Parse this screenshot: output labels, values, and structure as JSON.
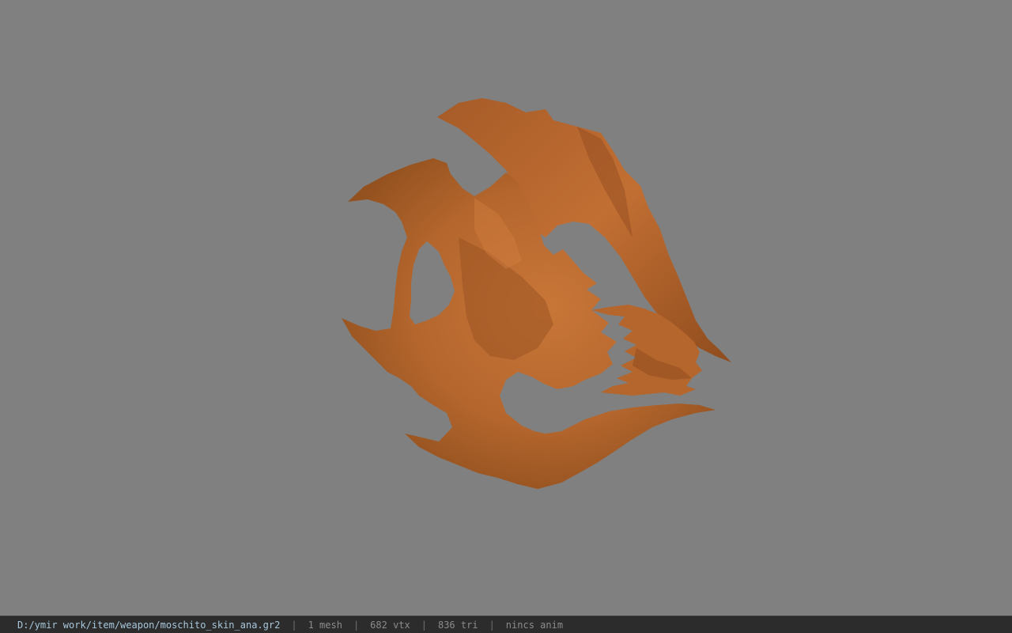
{
  "viewport": {
    "background_color": "#808080",
    "model": {
      "name": "moschito_skin_ana",
      "color": "#b8692f",
      "shade_color": "#8e4a1e",
      "highlight_color": "#d07d3e"
    }
  },
  "statusbar": {
    "file_path": "D:/ymir work/item/weapon/moschito_skin_ana.gr2",
    "separator": "|",
    "mesh": "1 mesh",
    "vtx": "682 vtx",
    "tri": "836 tri",
    "anim": "nincs anim"
  }
}
